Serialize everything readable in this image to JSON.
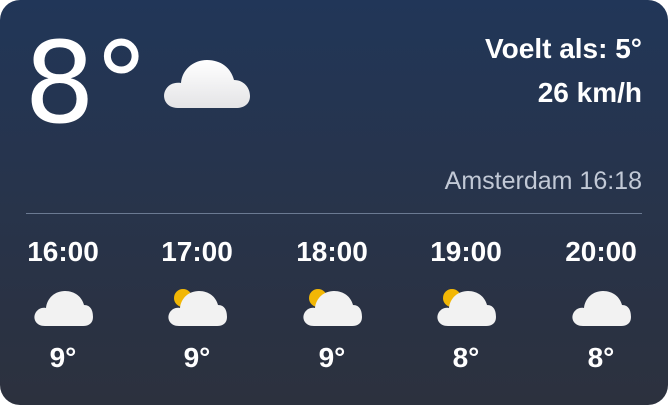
{
  "current": {
    "temperature": "8°",
    "icon": "cloud-icon",
    "feels_like": "Voelt als: 5°",
    "wind": "26 km/h",
    "location_time": "Amsterdam 16:18"
  },
  "hourly": [
    {
      "time": "16:00",
      "icon": "cloud-icon",
      "temp": "9°"
    },
    {
      "time": "17:00",
      "icon": "partly-cloudy-icon",
      "temp": "9°"
    },
    {
      "time": "18:00",
      "icon": "partly-cloudy-icon",
      "temp": "9°"
    },
    {
      "time": "19:00",
      "icon": "partly-cloudy-icon",
      "temp": "8°"
    },
    {
      "time": "20:00",
      "icon": "cloud-icon",
      "temp": "8°"
    }
  ],
  "colors": {
    "background_top": "#213658",
    "background_bottom": "#2c313e",
    "sun": "#f2b705",
    "cloud": "#f2f2f2"
  }
}
